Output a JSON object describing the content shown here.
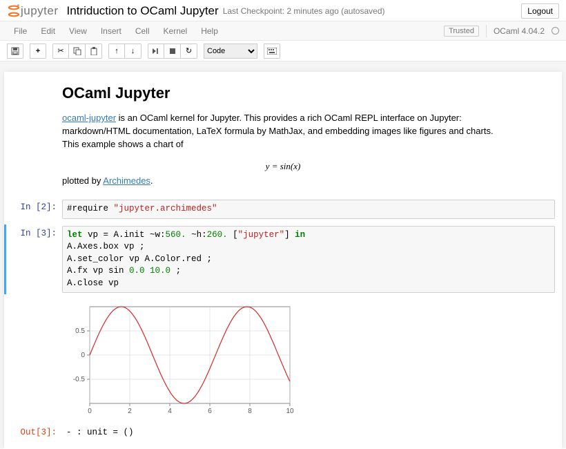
{
  "header": {
    "logo_text": "jupyter",
    "title": "Intriduction to OCaml Jupyter",
    "checkpoint": "Last Checkpoint: 2 minutes ago (autosaved)",
    "logout": "Logout"
  },
  "menubar": {
    "items": [
      "File",
      "Edit",
      "View",
      "Insert",
      "Cell",
      "Kernel",
      "Help"
    ],
    "trusted": "Trusted",
    "kernel": "OCaml 4.04.2"
  },
  "toolbar": {
    "cell_type_selected": "Code",
    "buttons": {
      "save": "💾",
      "add": "+",
      "cut": "✂",
      "copy": "⧉",
      "paste": "📋",
      "up": "▲",
      "down": "▼",
      "run": "▶|",
      "stop": "■",
      "restart": "↻",
      "command": "⌨"
    }
  },
  "markdown": {
    "heading": "OCaml Jupyter",
    "link1_text": "ocaml-jupyter",
    "para1_rest": " is an OCaml kernel for Jupyter. This provides a rich OCaml REPL interface on Jupyter: markdown/HTML documentation, LaTeX formula by MathJax, and embedding images like figures and charts. This example shows a chart of",
    "math": "y = sin(x)",
    "para2_pre": "plotted by ",
    "link2_text": "Archimedes",
    "dot": "."
  },
  "cells": [
    {
      "in_prompt": "In [2]:",
      "code_plain": "#require \"jupyter.archimedes\"",
      "code_html": "#require <span class=\"str\">\"jupyter.archimedes\"</span>"
    },
    {
      "in_prompt": "In [3]:",
      "code_plain": "let vp = A.init ~w:560. ~h:260. [\"jupyter\"] in\nA.Axes.box vp ;\nA.set_color vp A.Color.red ;\nA.fx vp sin 0.0 10.0 ;\nA.close vp",
      "code_html": "<span class=\"kw\">let</span> vp = A.init ~w:<span class=\"num\">560.</span> ~h:<span class=\"num\">260.</span> [<span class=\"str\">\"jupyter\"</span>] <span class=\"kw\">in</span>\nA.Axes.box vp ;\nA.set_color vp A.Color.red ;\nA.fx vp sin <span class=\"num\">0.0</span> <span class=\"num\">10.0</span> ;\nA.close vp",
      "out_prompt": "Out[3]:",
      "output": "- : unit = ()"
    }
  ],
  "chart_data": {
    "type": "line",
    "title": "",
    "xlabel": "",
    "ylabel": "",
    "xlim": [
      0,
      10
    ],
    "ylim": [
      -1,
      1
    ],
    "xticks": [
      0,
      2,
      4,
      6,
      8,
      10
    ],
    "yticks": [
      -0.5,
      0,
      0.5
    ],
    "color": "#d62728",
    "function": "y = sin(x)",
    "series": [
      {
        "name": "sin(x)",
        "x_range": [
          0,
          10
        ],
        "samples": 100,
        "values_note": "continuous sin(x) sampled over [0,10]"
      }
    ]
  }
}
